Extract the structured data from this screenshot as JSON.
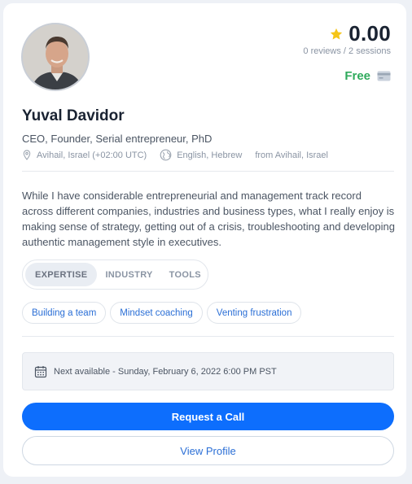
{
  "rating": {
    "score": "0.00",
    "reviews": "0 reviews / 2 sessions"
  },
  "price": {
    "label": "Free"
  },
  "profile": {
    "name": "Yuval Davidor",
    "title": "CEO, Founder, Serial entrepreneur, PhD",
    "location": "Avihail, Israel (+02:00 UTC)",
    "languages": "English, Hebrew",
    "from": "from Avihail, Israel",
    "bio": "While I have considerable entrepreneurial and management track record across different companies, industries and business types, what I really enjoy is making sense of strategy, getting out of a crisis, troubleshooting and developing authentic management style in executives."
  },
  "tabs": [
    {
      "label": "EXPERTISE"
    },
    {
      "label": "INDUSTRY"
    },
    {
      "label": "TOOLS"
    }
  ],
  "chips": [
    {
      "label": "Building a team"
    },
    {
      "label": "Mindset coaching"
    },
    {
      "label": "Venting frustration"
    }
  ],
  "next_available": "Next available - Sunday, February 6, 2022 6:00 PM PST",
  "buttons": {
    "request": "Request a Call",
    "view": "View Profile"
  },
  "colors": {
    "accent": "#0d6efd",
    "free": "#2faa5c",
    "star": "#f5c518",
    "link": "#2b6fd6"
  },
  "icons": {
    "star": "star-icon",
    "card": "credit-card-icon",
    "location": "location-pin-icon",
    "language": "globe-icon",
    "calendar": "calendar-icon"
  }
}
